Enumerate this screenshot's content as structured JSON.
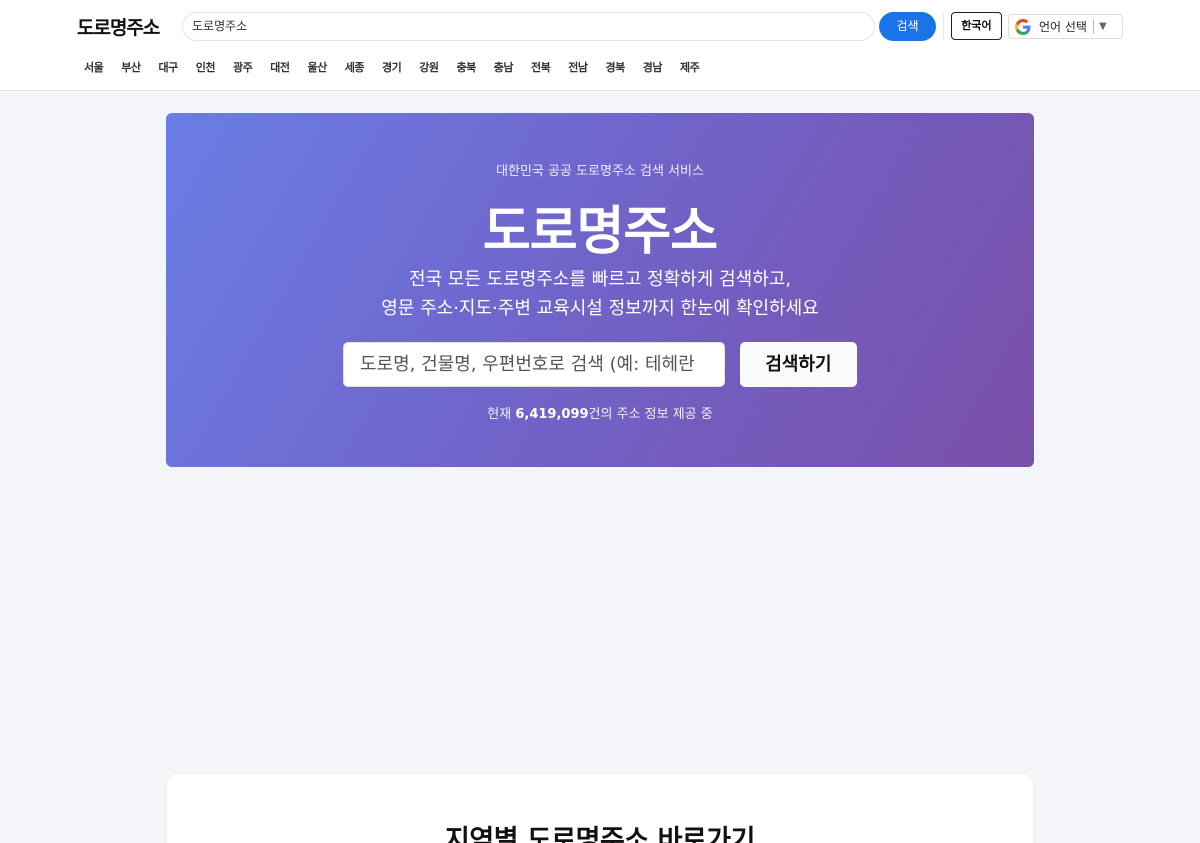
{
  "header": {
    "logo": "도로명주소",
    "search_value": "도로명주소",
    "search_button": "검색",
    "lang_button": "한국어",
    "translate_label": "언어 선택",
    "translate_arrow": "▼"
  },
  "regions": [
    "서울",
    "부산",
    "대구",
    "인천",
    "광주",
    "대전",
    "울산",
    "세종",
    "경기",
    "강원",
    "충북",
    "충남",
    "전북",
    "전남",
    "경북",
    "경남",
    "제주"
  ],
  "hero": {
    "kicker": "대한민국 공공 도로명주소 검색 서비스",
    "title": "도로명주소",
    "desc_line1": "전국 모든 도로명주소를 빠르고 정확하게 검색하고,",
    "desc_line2": "영문 주소·지도·주변 교육시설 정보까지 한눈에 확인하세요",
    "input_placeholder": "도로명, 건물명, 우편번호로 검색 (예: 테헤란",
    "button": "검색하기",
    "stat_prefix": "현재 ",
    "stat_count": "6,419,099",
    "stat_suffix": "건의 주소 정보 제공 중"
  },
  "region_section": {
    "title": "지역별 도로명주소 바로가기"
  },
  "colors": {
    "accent": "#1a73e8",
    "hero_start": "#6a7ee4",
    "hero_end": "#7a4fa9"
  }
}
